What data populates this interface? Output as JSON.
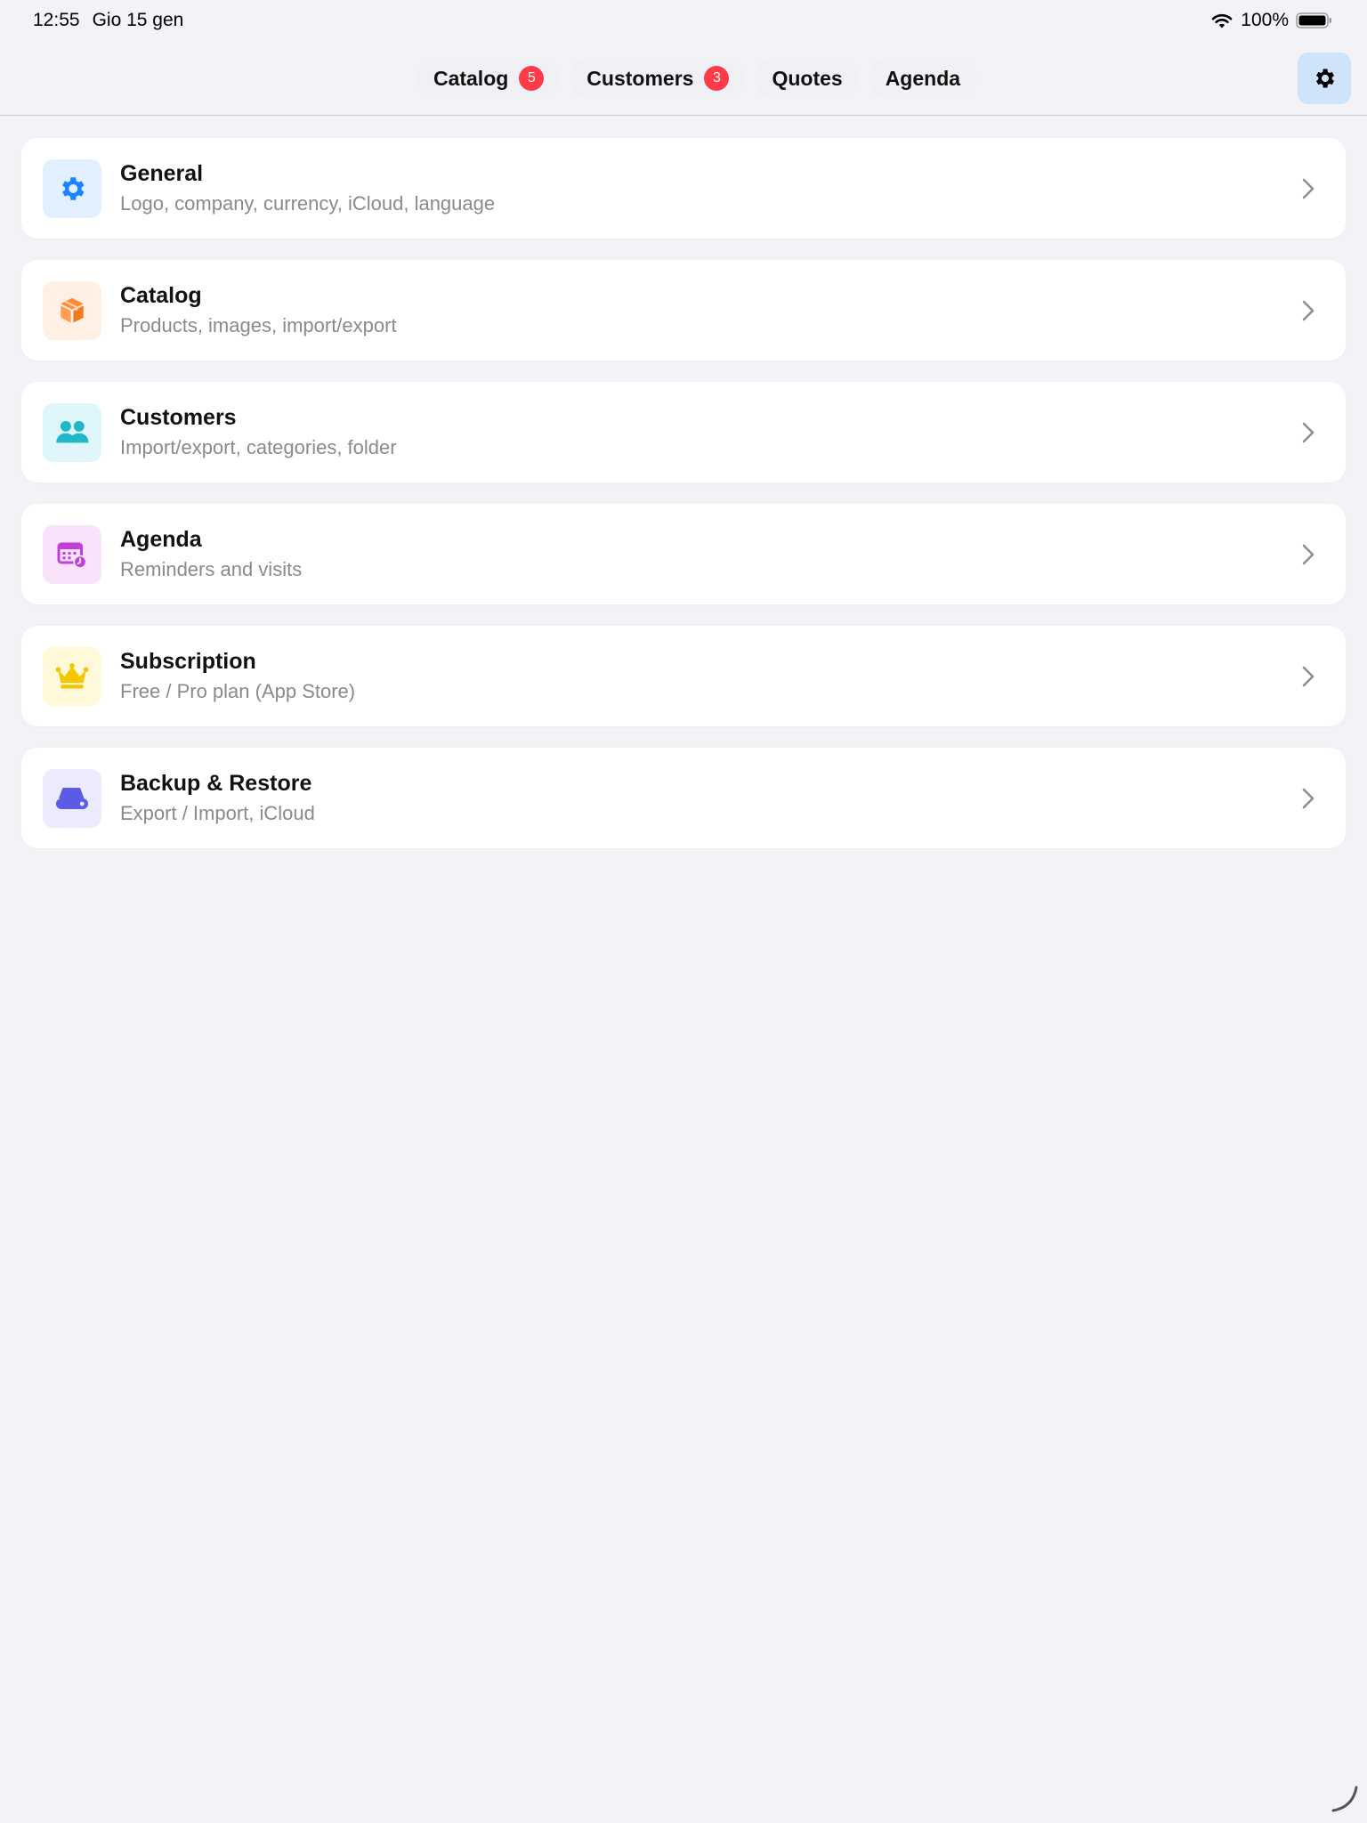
{
  "status_bar": {
    "time": "12:55",
    "date": "Gio 15 gen",
    "battery": "100%"
  },
  "nav": {
    "tabs": [
      {
        "label": "Catalog",
        "badge": "5"
      },
      {
        "label": "Customers",
        "badge": "3"
      },
      {
        "label": "Quotes"
      },
      {
        "label": "Agenda"
      }
    ],
    "settings_icon": "gear-icon"
  },
  "settings_list": [
    {
      "title": "General",
      "subtitle": "Logo, company, currency, iCloud, language",
      "icon": "gear-icon",
      "color": "#1a84ff",
      "bg": "#e2efff"
    },
    {
      "title": "Catalog",
      "subtitle": "Products, images, import/export",
      "icon": "box-icon",
      "color": "#ff8a33",
      "bg": "#fff0e3"
    },
    {
      "title": "Customers",
      "subtitle": "Import/export, categories, folder",
      "icon": "people-icon",
      "color": "#1fb8c9",
      "bg": "#def6f9"
    },
    {
      "title": "Agenda",
      "subtitle": "Reminders and visits",
      "icon": "calendar-clock-icon",
      "color": "#c23ddb",
      "bg": "#f8e3fb"
    },
    {
      "title": "Subscription",
      "subtitle": "Free / Pro plan (App Store)",
      "icon": "crown-icon",
      "color": "#f5c500",
      "bg": "#fff8d9"
    },
    {
      "title": "Backup & Restore",
      "subtitle": "Export / Import, iCloud",
      "icon": "drive-icon",
      "color": "#5b5ce6",
      "bg": "#ebebfd"
    }
  ]
}
